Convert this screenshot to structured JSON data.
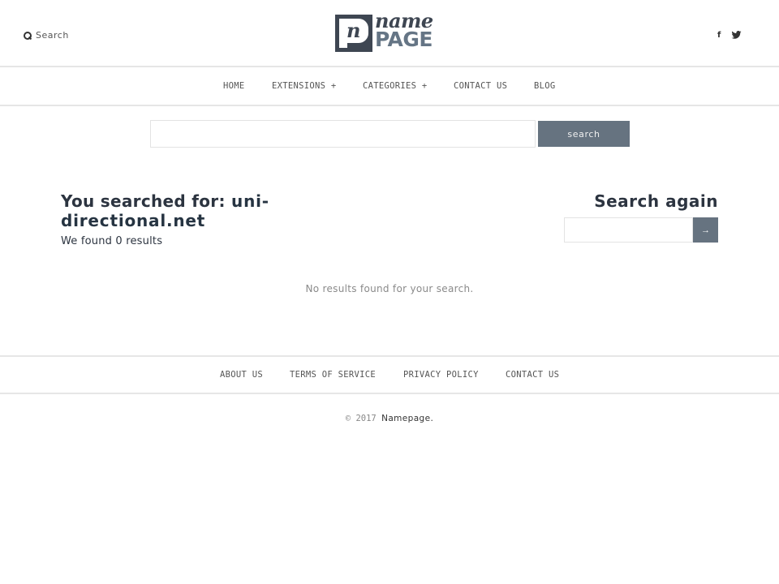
{
  "header": {
    "search_label": "Search",
    "search_icon": "magnifier-icon",
    "logo": {
      "mark_letter": "n",
      "word_top": "name",
      "word_bottom": "PAGE"
    },
    "social": [
      {
        "name": "facebook",
        "glyph": "f"
      },
      {
        "name": "twitter",
        "glyph": "bird"
      }
    ]
  },
  "nav": {
    "items": [
      {
        "label": "HOME"
      },
      {
        "label": "EXTENSIONS +"
      },
      {
        "label": "CATEGORIES +"
      },
      {
        "label": "CONTACT US"
      },
      {
        "label": "BLOG"
      }
    ]
  },
  "main_search": {
    "value": "",
    "placeholder": "",
    "button_label": "search"
  },
  "results": {
    "searched_prefix": "You searched for: ",
    "query": "uni-directional.net",
    "found_text": "We found 0 results",
    "empty_message": "No results found for your search."
  },
  "search_again": {
    "title": "Search again",
    "value": "",
    "button_label": "→"
  },
  "footer": {
    "links": [
      {
        "label": "ABOUT US"
      },
      {
        "label": "TERMS OF SERVICE"
      },
      {
        "label": "PRIVACY POLICY"
      },
      {
        "label": "CONTACT US"
      }
    ],
    "copyright_prefix": "© 2017",
    "copyright_brand": "Namepage."
  },
  "colors": {
    "accent": "#667380",
    "logo_dark": "#3e4652",
    "logo_light": "#657585",
    "text_dark": "#2c3440",
    "border": "#e6e6e6"
  }
}
